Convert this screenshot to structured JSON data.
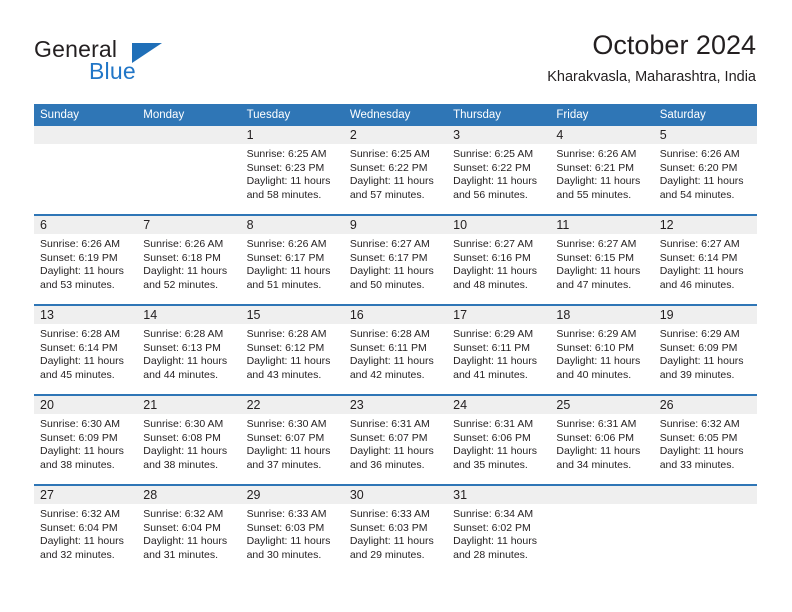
{
  "brand": {
    "name_part1": "General",
    "name_part2": "Blue",
    "logo_icon": "blue-triangle-flag-icon"
  },
  "header": {
    "month_title": "October 2024",
    "location": "Kharakvasla, Maharashtra, India"
  },
  "theme": {
    "accent_blue": "#2F76B6",
    "brand_blue": "#2176C7",
    "band_gray": "#EFEFEF",
    "text": "#231F20"
  },
  "calendar": {
    "weekday_headers": [
      "Sunday",
      "Monday",
      "Tuesday",
      "Wednesday",
      "Thursday",
      "Friday",
      "Saturday"
    ],
    "weeks": [
      [
        {
          "day": "",
          "sunrise": "",
          "sunset": "",
          "daylight1": "",
          "daylight2": ""
        },
        {
          "day": "",
          "sunrise": "",
          "sunset": "",
          "daylight1": "",
          "daylight2": ""
        },
        {
          "day": "1",
          "sunrise": "Sunrise: 6:25 AM",
          "sunset": "Sunset: 6:23 PM",
          "daylight1": "Daylight: 11 hours",
          "daylight2": "and 58 minutes."
        },
        {
          "day": "2",
          "sunrise": "Sunrise: 6:25 AM",
          "sunset": "Sunset: 6:22 PM",
          "daylight1": "Daylight: 11 hours",
          "daylight2": "and 57 minutes."
        },
        {
          "day": "3",
          "sunrise": "Sunrise: 6:25 AM",
          "sunset": "Sunset: 6:22 PM",
          "daylight1": "Daylight: 11 hours",
          "daylight2": "and 56 minutes."
        },
        {
          "day": "4",
          "sunrise": "Sunrise: 6:26 AM",
          "sunset": "Sunset: 6:21 PM",
          "daylight1": "Daylight: 11 hours",
          "daylight2": "and 55 minutes."
        },
        {
          "day": "5",
          "sunrise": "Sunrise: 6:26 AM",
          "sunset": "Sunset: 6:20 PM",
          "daylight1": "Daylight: 11 hours",
          "daylight2": "and 54 minutes."
        }
      ],
      [
        {
          "day": "6",
          "sunrise": "Sunrise: 6:26 AM",
          "sunset": "Sunset: 6:19 PM",
          "daylight1": "Daylight: 11 hours",
          "daylight2": "and 53 minutes."
        },
        {
          "day": "7",
          "sunrise": "Sunrise: 6:26 AM",
          "sunset": "Sunset: 6:18 PM",
          "daylight1": "Daylight: 11 hours",
          "daylight2": "and 52 minutes."
        },
        {
          "day": "8",
          "sunrise": "Sunrise: 6:26 AM",
          "sunset": "Sunset: 6:17 PM",
          "daylight1": "Daylight: 11 hours",
          "daylight2": "and 51 minutes."
        },
        {
          "day": "9",
          "sunrise": "Sunrise: 6:27 AM",
          "sunset": "Sunset: 6:17 PM",
          "daylight1": "Daylight: 11 hours",
          "daylight2": "and 50 minutes."
        },
        {
          "day": "10",
          "sunrise": "Sunrise: 6:27 AM",
          "sunset": "Sunset: 6:16 PM",
          "daylight1": "Daylight: 11 hours",
          "daylight2": "and 48 minutes."
        },
        {
          "day": "11",
          "sunrise": "Sunrise: 6:27 AM",
          "sunset": "Sunset: 6:15 PM",
          "daylight1": "Daylight: 11 hours",
          "daylight2": "and 47 minutes."
        },
        {
          "day": "12",
          "sunrise": "Sunrise: 6:27 AM",
          "sunset": "Sunset: 6:14 PM",
          "daylight1": "Daylight: 11 hours",
          "daylight2": "and 46 minutes."
        }
      ],
      [
        {
          "day": "13",
          "sunrise": "Sunrise: 6:28 AM",
          "sunset": "Sunset: 6:14 PM",
          "daylight1": "Daylight: 11 hours",
          "daylight2": "and 45 minutes."
        },
        {
          "day": "14",
          "sunrise": "Sunrise: 6:28 AM",
          "sunset": "Sunset: 6:13 PM",
          "daylight1": "Daylight: 11 hours",
          "daylight2": "and 44 minutes."
        },
        {
          "day": "15",
          "sunrise": "Sunrise: 6:28 AM",
          "sunset": "Sunset: 6:12 PM",
          "daylight1": "Daylight: 11 hours",
          "daylight2": "and 43 minutes."
        },
        {
          "day": "16",
          "sunrise": "Sunrise: 6:28 AM",
          "sunset": "Sunset: 6:11 PM",
          "daylight1": "Daylight: 11 hours",
          "daylight2": "and 42 minutes."
        },
        {
          "day": "17",
          "sunrise": "Sunrise: 6:29 AM",
          "sunset": "Sunset: 6:11 PM",
          "daylight1": "Daylight: 11 hours",
          "daylight2": "and 41 minutes."
        },
        {
          "day": "18",
          "sunrise": "Sunrise: 6:29 AM",
          "sunset": "Sunset: 6:10 PM",
          "daylight1": "Daylight: 11 hours",
          "daylight2": "and 40 minutes."
        },
        {
          "day": "19",
          "sunrise": "Sunrise: 6:29 AM",
          "sunset": "Sunset: 6:09 PM",
          "daylight1": "Daylight: 11 hours",
          "daylight2": "and 39 minutes."
        }
      ],
      [
        {
          "day": "20",
          "sunrise": "Sunrise: 6:30 AM",
          "sunset": "Sunset: 6:09 PM",
          "daylight1": "Daylight: 11 hours",
          "daylight2": "and 38 minutes."
        },
        {
          "day": "21",
          "sunrise": "Sunrise: 6:30 AM",
          "sunset": "Sunset: 6:08 PM",
          "daylight1": "Daylight: 11 hours",
          "daylight2": "and 38 minutes."
        },
        {
          "day": "22",
          "sunrise": "Sunrise: 6:30 AM",
          "sunset": "Sunset: 6:07 PM",
          "daylight1": "Daylight: 11 hours",
          "daylight2": "and 37 minutes."
        },
        {
          "day": "23",
          "sunrise": "Sunrise: 6:31 AM",
          "sunset": "Sunset: 6:07 PM",
          "daylight1": "Daylight: 11 hours",
          "daylight2": "and 36 minutes."
        },
        {
          "day": "24",
          "sunrise": "Sunrise: 6:31 AM",
          "sunset": "Sunset: 6:06 PM",
          "daylight1": "Daylight: 11 hours",
          "daylight2": "and 35 minutes."
        },
        {
          "day": "25",
          "sunrise": "Sunrise: 6:31 AM",
          "sunset": "Sunset: 6:06 PM",
          "daylight1": "Daylight: 11 hours",
          "daylight2": "and 34 minutes."
        },
        {
          "day": "26",
          "sunrise": "Sunrise: 6:32 AM",
          "sunset": "Sunset: 6:05 PM",
          "daylight1": "Daylight: 11 hours",
          "daylight2": "and 33 minutes."
        }
      ],
      [
        {
          "day": "27",
          "sunrise": "Sunrise: 6:32 AM",
          "sunset": "Sunset: 6:04 PM",
          "daylight1": "Daylight: 11 hours",
          "daylight2": "and 32 minutes."
        },
        {
          "day": "28",
          "sunrise": "Sunrise: 6:32 AM",
          "sunset": "Sunset: 6:04 PM",
          "daylight1": "Daylight: 11 hours",
          "daylight2": "and 31 minutes."
        },
        {
          "day": "29",
          "sunrise": "Sunrise: 6:33 AM",
          "sunset": "Sunset: 6:03 PM",
          "daylight1": "Daylight: 11 hours",
          "daylight2": "and 30 minutes."
        },
        {
          "day": "30",
          "sunrise": "Sunrise: 6:33 AM",
          "sunset": "Sunset: 6:03 PM",
          "daylight1": "Daylight: 11 hours",
          "daylight2": "and 29 minutes."
        },
        {
          "day": "31",
          "sunrise": "Sunrise: 6:34 AM",
          "sunset": "Sunset: 6:02 PM",
          "daylight1": "Daylight: 11 hours",
          "daylight2": "and 28 minutes."
        },
        {
          "day": "",
          "sunrise": "",
          "sunset": "",
          "daylight1": "",
          "daylight2": ""
        },
        {
          "day": "",
          "sunrise": "",
          "sunset": "",
          "daylight1": "",
          "daylight2": ""
        }
      ]
    ]
  }
}
